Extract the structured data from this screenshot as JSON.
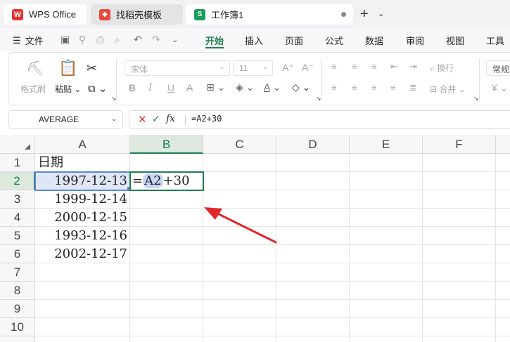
{
  "tabs": [
    {
      "label": "WPS Office",
      "icon": "wps-logo-icon"
    },
    {
      "label": "找稻壳模板",
      "icon": "docer-icon"
    },
    {
      "label": "工作簿1",
      "icon": "spreadsheet-icon",
      "icon_letter": "S"
    }
  ],
  "menu": {
    "file_label": "文件",
    "items": [
      "开始",
      "插入",
      "页面",
      "公式",
      "数据",
      "审阅",
      "视图",
      "工具"
    ],
    "active": "开始"
  },
  "ribbon": {
    "format_painter": "格式刷",
    "paste": "粘贴",
    "font_name": "宋体",
    "font_size": "11",
    "wrap_text": "换行",
    "merge": "合并",
    "number_format": "常规",
    "currency_symbol": "¥"
  },
  "formula_bar": {
    "name_box": "AVERAGE",
    "fx_label": "fx",
    "formula": "=A2+30"
  },
  "sheet": {
    "columns": [
      "A",
      "B",
      "C",
      "D",
      "E",
      "F"
    ],
    "rows": [
      "1",
      "2",
      "3",
      "4",
      "5",
      "6",
      "7",
      "8",
      "9",
      "10"
    ],
    "A1": "日期",
    "dates": [
      "1997-12-13",
      "1999-12-14",
      "2000-12-15",
      "1993-12-16",
      "2002-12-17"
    ],
    "B2_prefix": "=",
    "B2_ref": "A2",
    "B2_suffix": "+30"
  },
  "colors": {
    "accent": "#1f7f4e",
    "reference_highlight": "#c9d7f1",
    "arrow": "#e0282c"
  }
}
